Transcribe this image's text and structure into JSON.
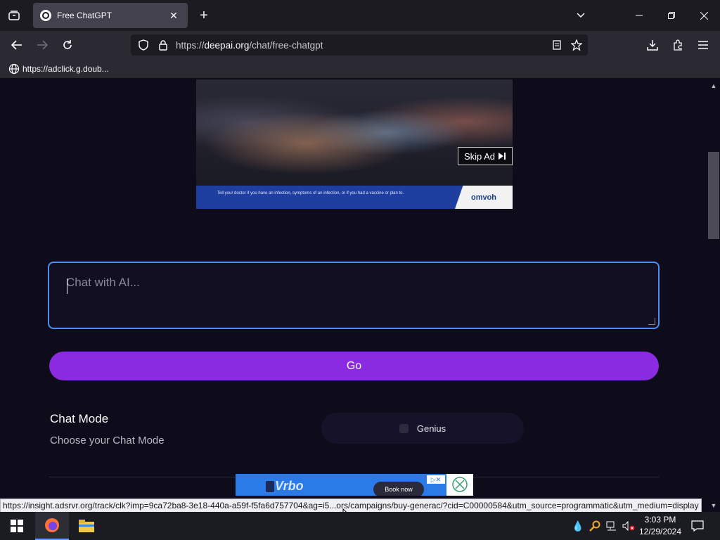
{
  "browser": {
    "tab_title": "Free ChatGPT",
    "url_protocol": "https://",
    "url_host": "deepai.org",
    "url_path": "/chat/free-chatgpt",
    "bookmark_label": "https://adclick.g.doub..."
  },
  "ad_top": {
    "skip_label": "Skip Ad",
    "fine_print": "Tell your doctor if you have an infection, symptoms of an infection, or if you had a vaccine or plan to.",
    "logo_text": "omvoh"
  },
  "chat": {
    "placeholder": "Chat with AI...",
    "go_label": "Go",
    "mode_title": "Chat Mode",
    "mode_subtitle": "Choose your Chat Mode",
    "mode_option": "Genius"
  },
  "ad_bottom": {
    "brand": "Vrbo",
    "book_label": "Book now"
  },
  "status_link": "https://insight.adsrvr.org/track/clk?imp=9ca72ba8-3e18-440a-a59f-f5fa6d757704&ag=i5...ors/campaigns/buy-generac/?cid=C00000584&utm_source=programmatic&utm_medium=display",
  "taskbar": {
    "time": "3:03 PM",
    "date": "12/29/2024"
  },
  "colors": {
    "page_bg": "#0e0b1a",
    "accent_purple": "#8a2be2",
    "focus_blue": "#4d8ff0"
  }
}
